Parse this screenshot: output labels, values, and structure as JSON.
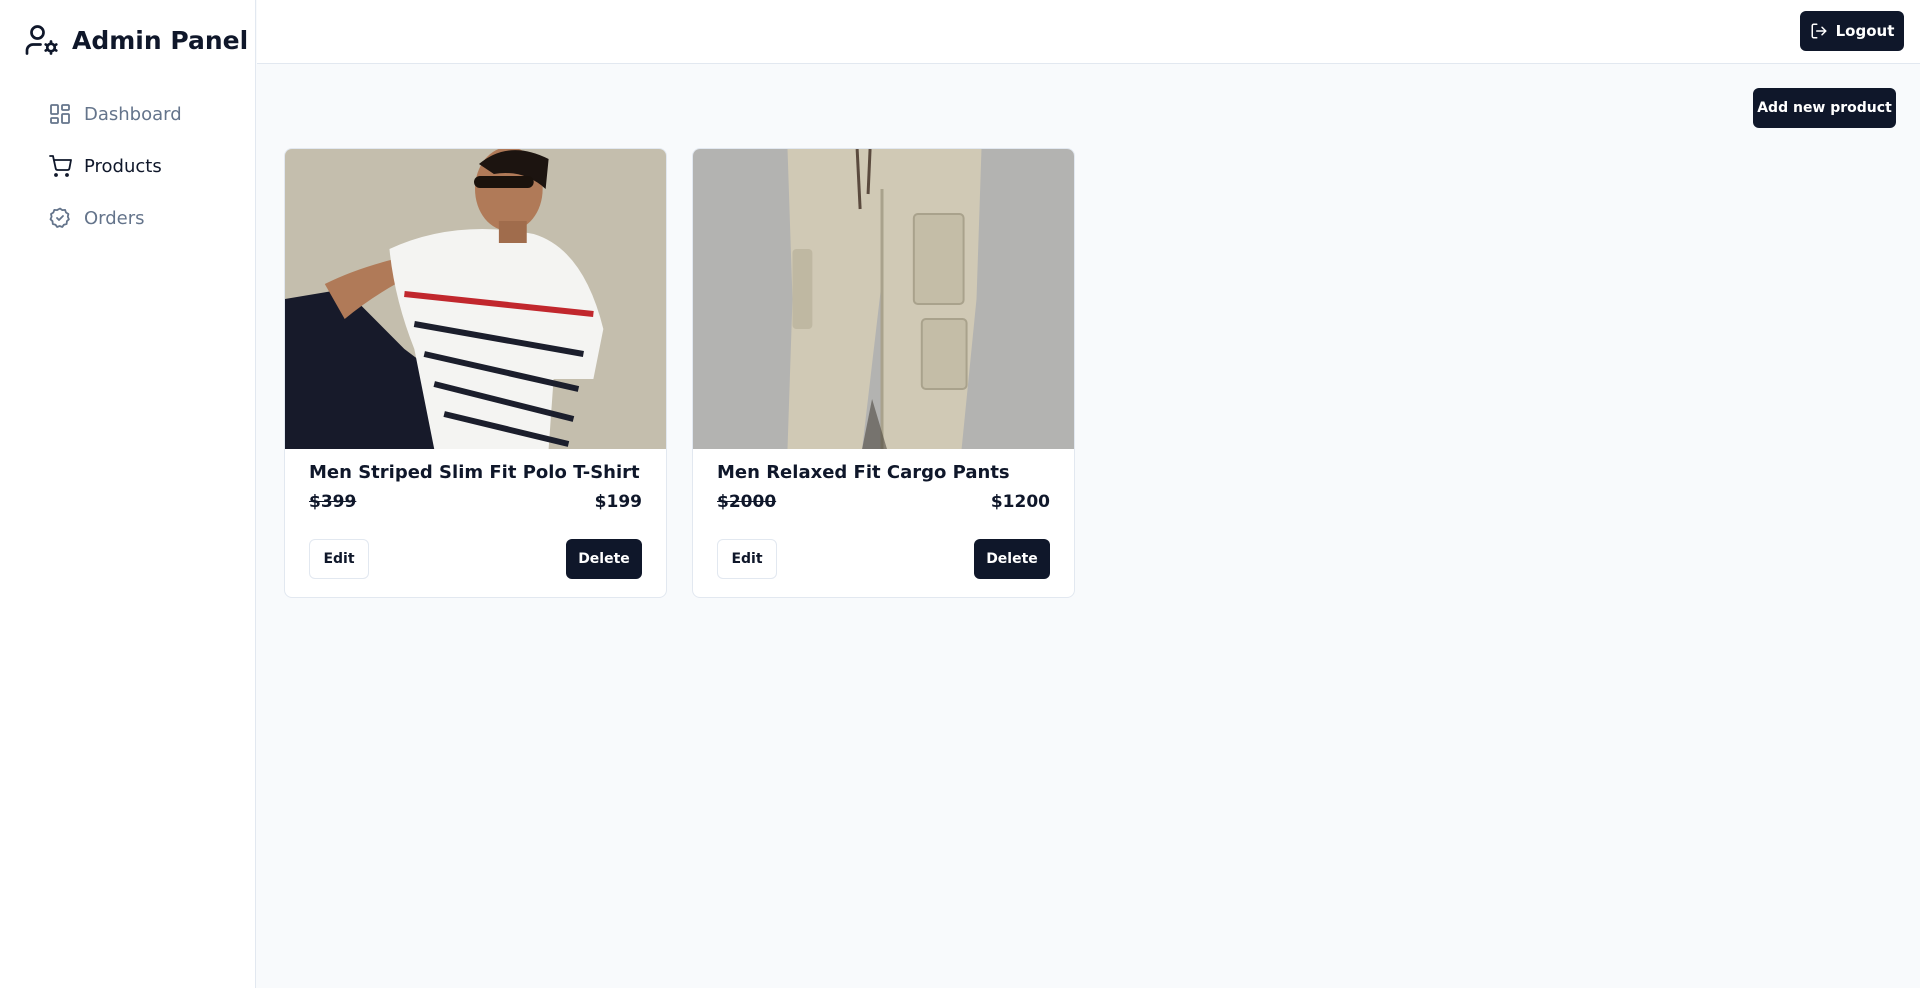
{
  "app": {
    "title": "Admin Panel",
    "brand_icon": "user-cog-icon"
  },
  "sidebar": {
    "items": [
      {
        "label": "Dashboard",
        "icon": "layout-dashboard-icon",
        "active": false
      },
      {
        "label": "Products",
        "icon": "shopping-cart-icon",
        "active": true
      },
      {
        "label": "Orders",
        "icon": "badge-check-icon",
        "active": false
      }
    ]
  },
  "header": {
    "logout_label": "Logout",
    "logout_icon": "log-out-icon"
  },
  "main": {
    "add_product_label": "Add new product"
  },
  "products": [
    {
      "title": "Men Striped Slim Fit Polo T-Shirt",
      "price": "$399",
      "sale_price": "$199",
      "edit_label": "Edit",
      "delete_label": "Delete"
    },
    {
      "title": "Men Relaxed Fit Cargo Pants",
      "price": "$2000",
      "sale_price": "$1200",
      "edit_label": "Edit",
      "delete_label": "Delete"
    }
  ],
  "colors": {
    "primary": "#0f172a",
    "muted_text": "#64748b",
    "page_bg": "#f8fafc",
    "border": "#e2e8f0"
  }
}
